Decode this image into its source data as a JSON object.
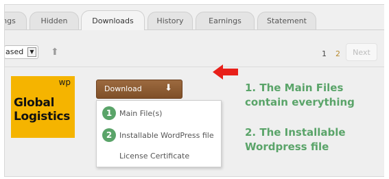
{
  "tabs": [
    {
      "label": "ngs",
      "active": false
    },
    {
      "label": "Hidden",
      "active": false
    },
    {
      "label": "Downloads",
      "active": true
    },
    {
      "label": "History",
      "active": false
    },
    {
      "label": "Earnings",
      "active": false
    },
    {
      "label": "Statement",
      "active": false
    }
  ],
  "toolbar": {
    "sort_value": "ased",
    "sort_icon": "chevron-down-icon",
    "up_icon": "arrow-up-icon"
  },
  "pagination": {
    "current_page": "1",
    "other_page": "2",
    "next_label": "Next"
  },
  "item": {
    "logo_badge": "wp",
    "logo_line1": "Global",
    "logo_line2": "Logistics",
    "logo_color": "#f5b400"
  },
  "download": {
    "button_label": "Download",
    "button_icon": "arrow-down-icon",
    "menu": [
      {
        "number": "1",
        "label": "Main File(s)"
      },
      {
        "number": "2",
        "label": "Installable WordPress file"
      },
      {
        "number": "",
        "label": "License Certificate"
      }
    ]
  },
  "annotations": {
    "note1_line1": "1. The Main Files",
    "note1_line2": "contain everything",
    "note2_line1": "2. The Installable",
    "note2_line2": "Wordpress file",
    "accent_color": "#5aa469",
    "pointer_color": "#e8201a",
    "pointer_icon": "arrow-left-icon"
  }
}
